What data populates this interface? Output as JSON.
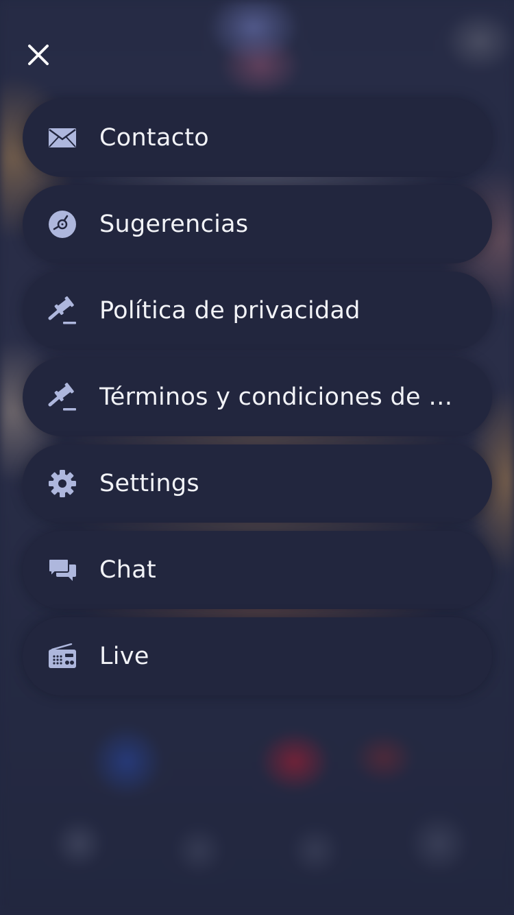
{
  "colors": {
    "background": "#232842",
    "item_background": "#22263e",
    "icon": "#aeb7dd",
    "text": "#f2f3f7"
  },
  "close": {
    "icon": "close-icon"
  },
  "menu": {
    "items": [
      {
        "label": "Contacto",
        "icon": "envelope-icon"
      },
      {
        "label": "Sugerencias",
        "icon": "disc-icon"
      },
      {
        "label": "Política de privacidad",
        "icon": "gavel-icon"
      },
      {
        "label": "Términos y condiciones de v...",
        "icon": "gavel-icon"
      },
      {
        "label": "Settings",
        "icon": "gear-icon"
      },
      {
        "label": "Chat",
        "icon": "chat-bubbles-icon"
      },
      {
        "label": "Live",
        "icon": "radio-icon"
      }
    ]
  }
}
